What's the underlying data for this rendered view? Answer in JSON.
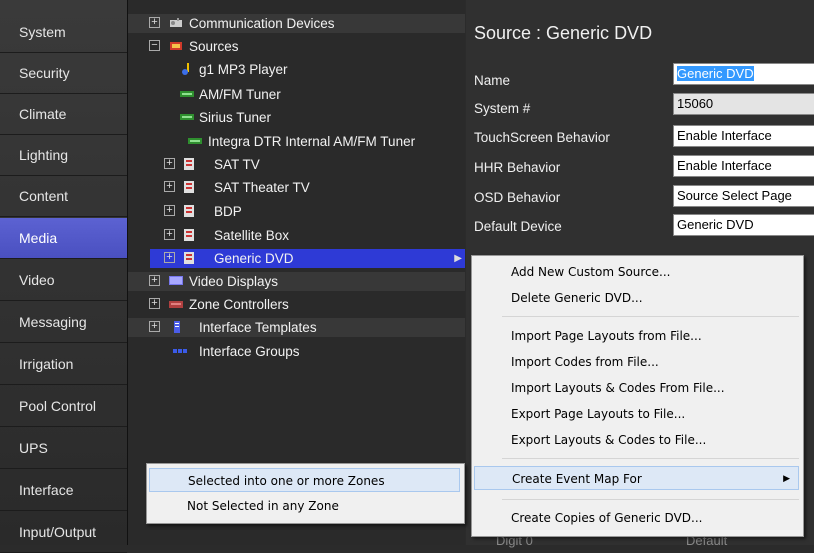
{
  "nav": {
    "items": [
      {
        "label": "System"
      },
      {
        "label": "Security"
      },
      {
        "label": "Climate"
      },
      {
        "label": "Lighting"
      },
      {
        "label": "Content"
      },
      {
        "label": "Media"
      },
      {
        "label": "Video"
      },
      {
        "label": "Messaging"
      },
      {
        "label": "Irrigation"
      },
      {
        "label": "Pool Control"
      },
      {
        "label": "UPS"
      },
      {
        "label": "Interface"
      },
      {
        "label": "Input/Output"
      }
    ],
    "active": "Media"
  },
  "tree": {
    "rows": [
      {
        "label": "Communication Devices"
      },
      {
        "label": "Sources"
      },
      {
        "label": "g1 MP3 Player"
      },
      {
        "label": "AM/FM Tuner"
      },
      {
        "label": "Sirius Tuner"
      },
      {
        "label": "Integra DTR Internal AM/FM Tuner"
      },
      {
        "label": "SAT TV"
      },
      {
        "label": "SAT Theater TV"
      },
      {
        "label": "BDP"
      },
      {
        "label": "Satellite Box"
      },
      {
        "label": "Generic DVD"
      },
      {
        "label": "Video Displays"
      },
      {
        "label": "Zone Controllers"
      },
      {
        "label": "Interface Templates"
      },
      {
        "label": "Interface Groups"
      }
    ],
    "selected": "Generic DVD"
  },
  "props": {
    "title": "Source : Generic DVD",
    "fields": [
      {
        "label": "Name",
        "value": "Generic DVD"
      },
      {
        "label": "System #",
        "value": "15060"
      },
      {
        "label": "TouchScreen Behavior",
        "value": "Enable Interface"
      },
      {
        "label": "HHR Behavior",
        "value": "Enable Interface"
      },
      {
        "label": "OSD Behavior",
        "value": "Source Select Page"
      },
      {
        "label": "Default Device",
        "value": "Generic DVD"
      }
    ],
    "ghost_row": {
      "label": "Digit 0",
      "value": "Default"
    }
  },
  "context_menu": {
    "items": [
      {
        "label": "Add New Custom Source..."
      },
      {
        "label": "Delete Generic DVD..."
      },
      {
        "label": "Import Page Layouts from File..."
      },
      {
        "label": "Import Codes from File..."
      },
      {
        "label": "Import Layouts & Codes From File..."
      },
      {
        "label": "Export Page Layouts to File..."
      },
      {
        "label": "Export Layouts & Codes to File..."
      },
      {
        "label": "Create Event Map For"
      },
      {
        "label": "Create Copies of Generic DVD..."
      }
    ],
    "submenu_arrow": "▶"
  },
  "submenu": {
    "items": [
      {
        "label": "Selected into one or more Zones"
      },
      {
        "label": "Not Selected in any Zone"
      }
    ]
  },
  "colors": {
    "nav_active": "#5058c8",
    "tree_selected": "#2e3ad6",
    "menu_bg": "#f0f0f0",
    "menu_hover": "#dde8f6"
  }
}
